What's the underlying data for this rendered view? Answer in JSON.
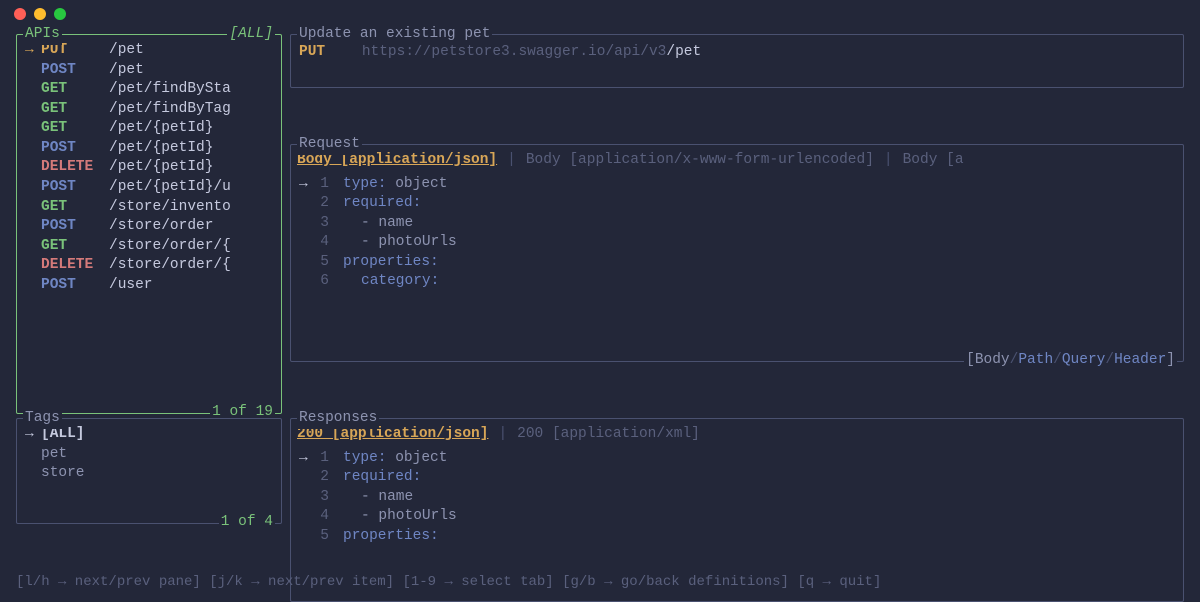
{
  "sidebar": {
    "apis_title": "APIs",
    "apis_filter": "[ALL]",
    "apis_footer": "1 of 19",
    "items": [
      {
        "method": "PUT",
        "mclass": "m-put",
        "path": "/pet",
        "selected": true
      },
      {
        "method": "POST",
        "mclass": "m-post",
        "path": "/pet"
      },
      {
        "method": "GET",
        "mclass": "m-get",
        "path": "/pet/findBySta"
      },
      {
        "method": "GET",
        "mclass": "m-get",
        "path": "/pet/findByTag"
      },
      {
        "method": "GET",
        "mclass": "m-get",
        "path": "/pet/{petId}"
      },
      {
        "method": "POST",
        "mclass": "m-post",
        "path": "/pet/{petId}"
      },
      {
        "method": "DELETE",
        "mclass": "m-del",
        "path": "/pet/{petId}"
      },
      {
        "method": "POST",
        "mclass": "m-post",
        "path": "/pet/{petId}/u"
      },
      {
        "method": "GET",
        "mclass": "m-get",
        "path": "/store/invento"
      },
      {
        "method": "POST",
        "mclass": "m-post",
        "path": "/store/order"
      },
      {
        "method": "GET",
        "mclass": "m-get",
        "path": "/store/order/{"
      },
      {
        "method": "DELETE",
        "mclass": "m-del",
        "path": "/store/order/{"
      },
      {
        "method": "POST",
        "mclass": "m-post",
        "path": "/user"
      }
    ],
    "tags_title": "Tags",
    "tags_footer": "1 of 4",
    "tags": [
      {
        "label": "[ALL]",
        "selected": true
      },
      {
        "label": "pet"
      },
      {
        "label": "store"
      }
    ]
  },
  "detail": {
    "title": "Update an existing pet",
    "method": "PUT",
    "host": "https://petstore3.swagger.io/api/v3",
    "endpoint": "/pet"
  },
  "request": {
    "title": "Request",
    "tabs": [
      {
        "label": "Body [application/json]",
        "active": true
      },
      {
        "label": "Body [application/x-www-form-urlencoded]"
      },
      {
        "label": "Body [a"
      }
    ],
    "footer_nav": {
      "body": "Body",
      "path": "Path",
      "query": "Query",
      "header": "Header"
    },
    "lines": [
      {
        "n": "1",
        "kw": "type: ",
        "rest": "object",
        "sel": true
      },
      {
        "n": "2",
        "kw": "required:",
        "rest": ""
      },
      {
        "n": "3",
        "kw": "",
        "rest": "- name",
        "indent": true
      },
      {
        "n": "4",
        "kw": "",
        "rest": "- photoUrls",
        "indent": true
      },
      {
        "n": "5",
        "kw": "properties:",
        "rest": ""
      },
      {
        "n": "6",
        "kw": "",
        "rest": "category:",
        "indent": true,
        "restIsKw": true
      }
    ]
  },
  "responses": {
    "title": "Responses",
    "tabs": [
      {
        "label": "200 [application/json]",
        "active": true
      },
      {
        "label": "200 [application/xml]"
      }
    ],
    "lines": [
      {
        "n": "1",
        "kw": "type: ",
        "rest": "object",
        "sel": true
      },
      {
        "n": "2",
        "kw": "required:",
        "rest": ""
      },
      {
        "n": "3",
        "kw": "",
        "rest": "- name",
        "indent": true
      },
      {
        "n": "4",
        "kw": "",
        "rest": "- photoUrls",
        "indent": true
      },
      {
        "n": "5",
        "kw": "properties:",
        "rest": ""
      }
    ]
  },
  "help": {
    "items": [
      "[l/h → next/prev pane]",
      "[j/k → next/prev item]",
      "[1-9 → select tab]",
      "[g/b → go/back definitions]",
      "[q → quit]"
    ]
  }
}
